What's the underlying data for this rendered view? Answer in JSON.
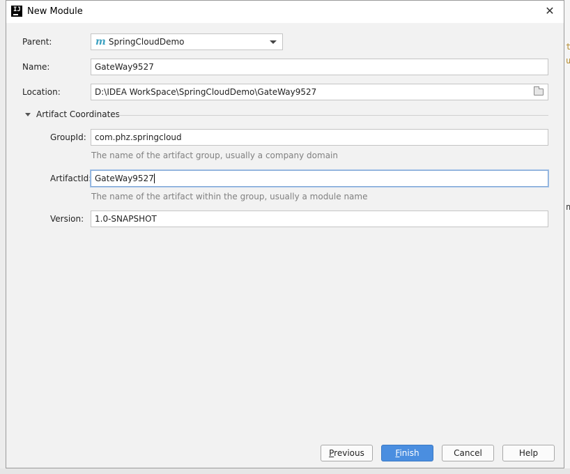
{
  "window": {
    "title": "New Module",
    "close_glyph": "✕"
  },
  "form": {
    "parent_label": "Parent:",
    "parent_value": "SpringCloudDemo",
    "parent_icon": "m",
    "name_label": "Name:",
    "name_value": "GateWay9527",
    "location_label": "Location:",
    "location_value": "D:\\IDEA WorkSpace\\SpringCloudDemo\\GateWay9527"
  },
  "artifact": {
    "section_label": "Artifact Coordinates",
    "group_label": "GroupId:",
    "group_value": "com.phz.springcloud",
    "group_hint": "The name of the artifact group, usually a company domain",
    "artifact_label": "ArtifactId:",
    "artifact_value": "GateWay9527",
    "artifact_hint": "The name of the artifact within the group, usually a module name",
    "version_label": "Version:",
    "version_value": "1.0-SNAPSHOT"
  },
  "buttons": {
    "previous": "Previous",
    "finish": "Finish",
    "cancel": "Cancel",
    "help": "Help"
  },
  "background": {
    "glyph_1": "t",
    "glyph_2": "u",
    "glyph_3": "n"
  },
  "colors": {
    "accent": "#4a8ee0",
    "focus_border": "#7fa6d6",
    "hint_text": "#808080",
    "maven_icon": "#3ea2c2"
  },
  "icons": [
    "intellij-app-icon",
    "close-icon",
    "maven-module-icon",
    "dropdown-arrow-icon",
    "folder-browse-icon",
    "collapse-triangle-icon"
  ]
}
